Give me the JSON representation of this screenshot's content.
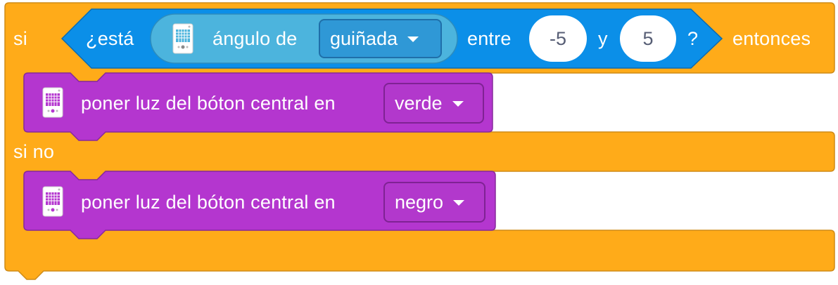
{
  "colors": {
    "control_block": "#ffab19",
    "control_border": "#cf8b17",
    "sensor_block": "#0b8fe8",
    "sensor_border": "#0b6bb0",
    "sensor_reporter": "#4cb4dd",
    "light_block": "#b436cf",
    "light_border": "#862a9c"
  },
  "if_else": {
    "if_label": "si",
    "then_label": "entonces",
    "else_label": "si no"
  },
  "condition": {
    "is_label": "¿está",
    "reporter": {
      "icon": "hub-icon",
      "label": "ángulo de",
      "axis_selected": "guiñada"
    },
    "between_label": "entre",
    "low_value": "-5",
    "and_label": "y",
    "high_value": "5",
    "question_mark": "?"
  },
  "then_action": {
    "icon": "hub-icon",
    "label": "poner luz del bóton central en",
    "color_selected": "verde"
  },
  "else_action": {
    "icon": "hub-icon",
    "label": "poner luz del bóton central en",
    "color_selected": "negro"
  }
}
